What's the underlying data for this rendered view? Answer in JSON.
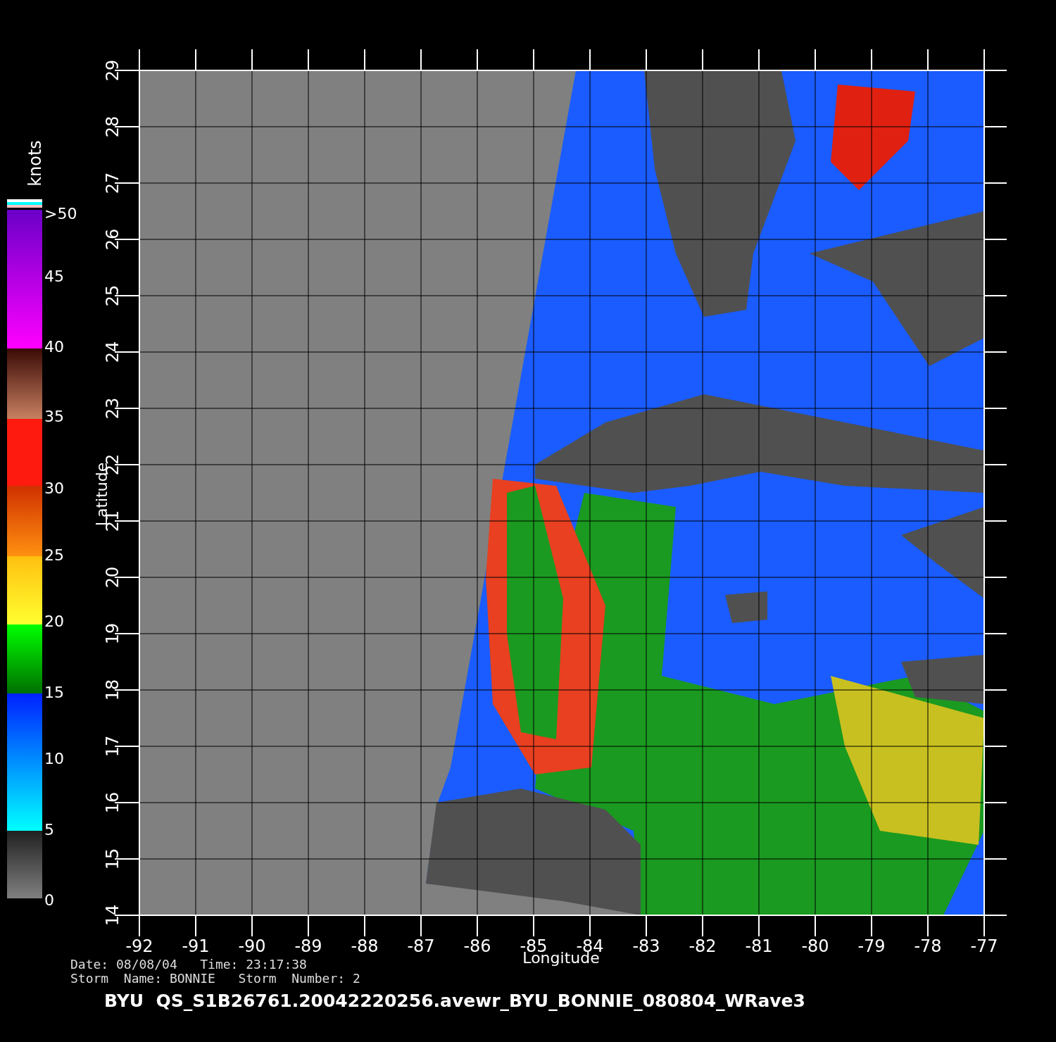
{
  "color_scale": {
    "title": "knots",
    "labels": [
      ">50",
      "45",
      "40",
      "35",
      "30",
      "25",
      "20",
      "15",
      "10",
      "5",
      "0"
    ]
  },
  "plot": {
    "y_axis": {
      "title": "Latitude",
      "ticks": [
        "29",
        "28",
        "27",
        "26",
        "25",
        "24",
        "23",
        "22",
        "21",
        "20",
        "19",
        "18",
        "17",
        "16",
        "15",
        "14"
      ]
    },
    "x_axis": {
      "title": "Longitude",
      "ticks": [
        "-92",
        "-91",
        "-90",
        "-89",
        "-88",
        "-87",
        "-86",
        "-85",
        "-84",
        "-83",
        "-82",
        "-81",
        "-80",
        "-79",
        "-78",
        "-77"
      ]
    }
  },
  "info": [
    "Date: 08/08/04   Time: 23:17:38",
    "Storm  Name: BONNIE   Storm  Number: 2"
  ],
  "title": "BYU  QS_S1B26761.20042220256.avewr_BYU_BONNIE_080804_WRave3"
}
